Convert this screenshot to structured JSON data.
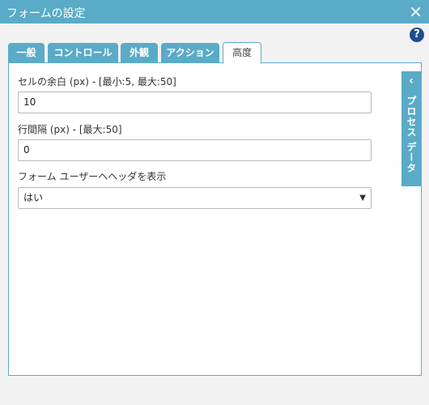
{
  "window": {
    "title": "フォームの設定",
    "close_icon": "×"
  },
  "help_icon": "?",
  "tabs": [
    {
      "label": "一般",
      "active": false
    },
    {
      "label": "コントロール",
      "active": false
    },
    {
      "label": "外観",
      "active": false
    },
    {
      "label": "アクション",
      "active": false
    },
    {
      "label": "高度",
      "active": true
    }
  ],
  "form": {
    "cell_padding": {
      "label": "セルの余白 (px) - [最小:5, 最大:50]",
      "value": "10"
    },
    "line_spacing": {
      "label": "行間隔 (px) - [最大:50]",
      "value": "0"
    },
    "show_header": {
      "label": "フォーム ユーザーヘヘッダを表示",
      "value": "はい"
    }
  },
  "side_panel": {
    "chevron": "‹",
    "label": "プロセス データ"
  },
  "colors": {
    "accent": "#5aabc7",
    "help": "#1f4e8e"
  }
}
